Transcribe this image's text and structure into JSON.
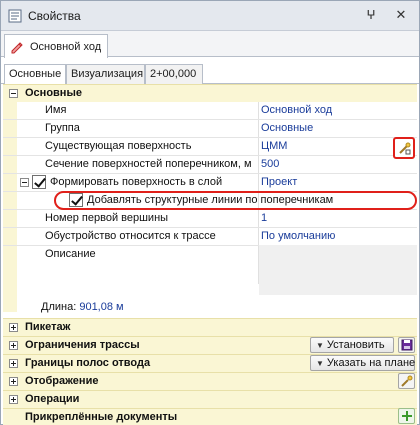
{
  "window": {
    "title": "Свойства",
    "pin_glyph": "ⵖ",
    "close_glyph": "✕"
  },
  "object_tab": {
    "label": "Основной ход",
    "icon": "route-pencil-icon"
  },
  "tabs": [
    {
      "label": "Основные"
    },
    {
      "label": "Визуализация"
    },
    {
      "label": "2+00,000"
    }
  ],
  "sections": {
    "main": {
      "title": "Основные"
    },
    "pickets": {
      "title": "Пикетаж"
    },
    "restrictions": {
      "title": "Ограничения трассы",
      "button": "Установить"
    },
    "boundaries": {
      "title": "Границы полос отвода",
      "button": "Указать на плане"
    },
    "display": {
      "title": "Отображение"
    },
    "operations": {
      "title": "Операции"
    },
    "docs": {
      "title": "Прикреплённые документы"
    }
  },
  "properties": [
    {
      "label": "Имя",
      "value": "Основной ход"
    },
    {
      "label": "Группа",
      "value": "Основные"
    },
    {
      "label": "Существующая поверхность",
      "value": "ЦММ"
    },
    {
      "label": "Сечение поверхностей поперечником, м",
      "value": "500"
    },
    {
      "label": "Формировать поверхность в слой",
      "value": "Проект",
      "checked": true
    },
    {
      "label": "Добавлять структурные линии по поперечникам",
      "value": "",
      "checked": true
    },
    {
      "label": "Номер первой вершины",
      "value": "1"
    },
    {
      "label": "Обустройство относится к трассе",
      "value": "По умолчанию"
    },
    {
      "label": "Описание",
      "value": ""
    }
  ],
  "length": {
    "label": "Длина:",
    "value": "901,08 м"
  },
  "colors": {
    "accent_red": "#e0201a",
    "link_blue": "#1a3c9a",
    "section_bg": "#faf6d4"
  }
}
